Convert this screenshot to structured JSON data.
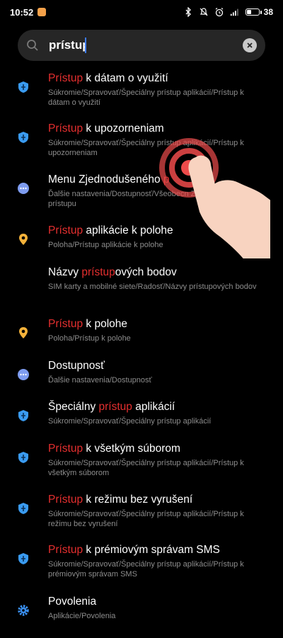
{
  "status_bar": {
    "time": "10:52",
    "battery_text": "38",
    "battery_level": 0.38
  },
  "search": {
    "query": "prístup",
    "placeholder": ""
  },
  "results": [
    {
      "title_pre": "",
      "title_hl": "Prístup",
      "title_post": " k dátam o využití",
      "subtitle": "Súkromie/Spravovať/Špeciálny prístup aplikácií/Prístup k dátam o využití",
      "icon": "privacy-icon"
    },
    {
      "title_pre": "",
      "title_hl": "Prístup",
      "title_post": " k upozorneniam",
      "subtitle": "Súkromie/Spravovať/Špeciálny prístup aplikácií/Prístup k upozorneniam",
      "icon": "privacy-icon"
    },
    {
      "title_pre": "Menu Zjednodušeného ",
      "title_hl": "p",
      "title_post": "",
      "subtitle": "Ďalšie nastavenia/Dostupnosť/Všeobecn Zjednodušeného prístupu",
      "icon": "more-settings-icon"
    },
    {
      "title_pre": "",
      "title_hl": "Prístup",
      "title_post": " aplikácie k polohe",
      "subtitle": "Poloha/Prístup aplikácie k polohe",
      "icon": "location-icon"
    },
    {
      "title_pre": "Názvy ",
      "title_hl": "prístup",
      "title_post": "ových bodov",
      "subtitle": "SIM karty a mobilné siete/Radosť/Názvy prístupových bodov",
      "icon": ""
    },
    {
      "title_pre": "",
      "title_hl": "Prístup",
      "title_post": " k polohe",
      "subtitle": "Poloha/Prístup k polohe",
      "icon": "location-icon"
    },
    {
      "title_pre": "Dostupnosť",
      "title_hl": "",
      "title_post": "",
      "subtitle": "Ďalšie nastavenia/Dostupnosť",
      "icon": "more-settings-icon"
    },
    {
      "title_pre": "Špeciálny ",
      "title_hl": "prístup",
      "title_post": " aplikácií",
      "subtitle": "Súkromie/Spravovať/Špeciálny prístup aplikácií",
      "icon": "privacy-icon"
    },
    {
      "title_pre": "",
      "title_hl": "Prístup",
      "title_post": " k všetkým súborom",
      "subtitle": "Súkromie/Spravovať/Špeciálny prístup aplikácií/Prístup k všetkým súborom",
      "icon": "privacy-icon"
    },
    {
      "title_pre": "",
      "title_hl": "Prístup",
      "title_post": " k režimu bez vyrušení",
      "subtitle": "Súkromie/Spravovať/Špeciálny prístup aplikácií/Prístup k režimu bez vyrušení",
      "icon": "privacy-icon"
    },
    {
      "title_pre": "",
      "title_hl": "Prístup",
      "title_post": " k prémiovým správam SMS",
      "subtitle": "Súkromie/Spravovať/Špeciálny prístup aplikácií/Prístup k prémiovým správam SMS",
      "icon": "privacy-icon"
    },
    {
      "title_pre": "Povolenia",
      "title_hl": "",
      "title_post": "",
      "subtitle": "Aplikácie/Povolenia",
      "icon": "gear-icon"
    }
  ],
  "colors": {
    "highlight": "#e52f2f",
    "privacy_icon": "#3a9bf0",
    "location_icon": "#f4b23a",
    "more_settings_icon": "#7e9cf0",
    "gear_icon": "#3a8ff0"
  }
}
